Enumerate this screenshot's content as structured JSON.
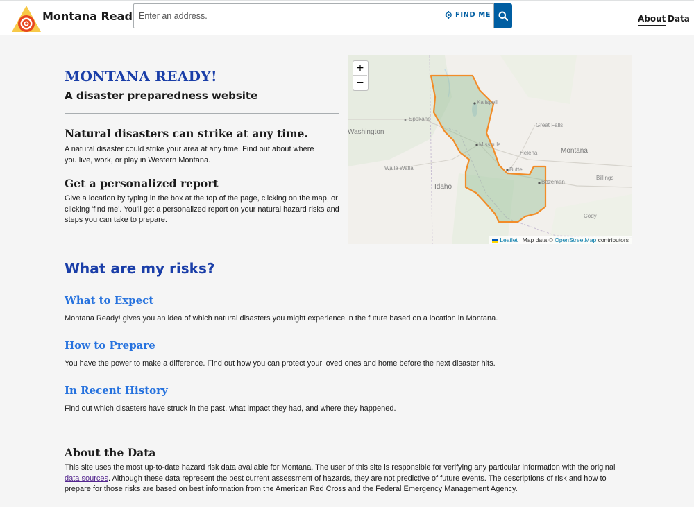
{
  "header": {
    "brand": "Montana Ready!",
    "search_placeholder": "Enter an address.",
    "find_me_label": "FIND ME",
    "nav": {
      "about": "About",
      "data": "Data"
    }
  },
  "intro": {
    "title": "MONTANA READY!",
    "subtitle": "A disaster preparedness website",
    "sections": [
      {
        "heading": "Natural disasters can strike at any time.",
        "body": "A natural disaster could strike your area at any time. Find out about where you live, work, or play in Western Montana."
      },
      {
        "heading": "Get a personalized report",
        "body": "Give a location by typing in the box at the top of the page, clicking on the map, or clicking 'find me'. You'll get a personalized report on your natural hazard risks and steps you can take to prepare."
      }
    ]
  },
  "map": {
    "zoom_in": "+",
    "zoom_out": "−",
    "attribution": {
      "leaflet": "Leaflet",
      "sep": " | Map data © ",
      "osm": "OpenStreetMap",
      "suffix": " contributors"
    },
    "places": {
      "kalispell": "Kalispell",
      "spokane": "Spokane",
      "missoula": "Missoula",
      "great_falls": "Great Falls",
      "helena": "Helena",
      "montana": "Montana",
      "walla_walla": "Walla Walla",
      "idaho": "Idaho",
      "butte": "Butte",
      "bozeman": "Bozeman",
      "billings": "Billings",
      "cody": "Cody",
      "washington": "Washington"
    },
    "boundary_color": "#f28c28"
  },
  "risks": {
    "title": "What are my risks?",
    "items": [
      {
        "heading": "What to Expect",
        "body": "Montana Ready! gives you an idea of which natural disasters you might experience in the future based on a location in Montana."
      },
      {
        "heading": "How to Prepare",
        "body": "You have the power to make a difference. Find out how you can protect your loved ones and home before the next disaster hits."
      },
      {
        "heading": "In Recent History",
        "body": "Find out which disasters have struck in the past, what impact they had, and where they happened."
      }
    ]
  },
  "about": {
    "heading": "About the Data",
    "body_before": "This site uses the most up-to-date hazard risk data available for Montana. The user of this site is responsible for verifying any particular information with the original ",
    "link": "data sources",
    "body_after": ". Although these data represent the best current assessment of hazards, they are not predictive of future events. The descriptions of risk and how to prepare for those risks are based on best information from the American Red Cross and the Federal Emergency Management Agency."
  },
  "colors": {
    "primary_dark": "#1a3ea8",
    "link_blue": "#2672de",
    "button_blue": "#005ea2",
    "visited_link": "#54278f"
  }
}
